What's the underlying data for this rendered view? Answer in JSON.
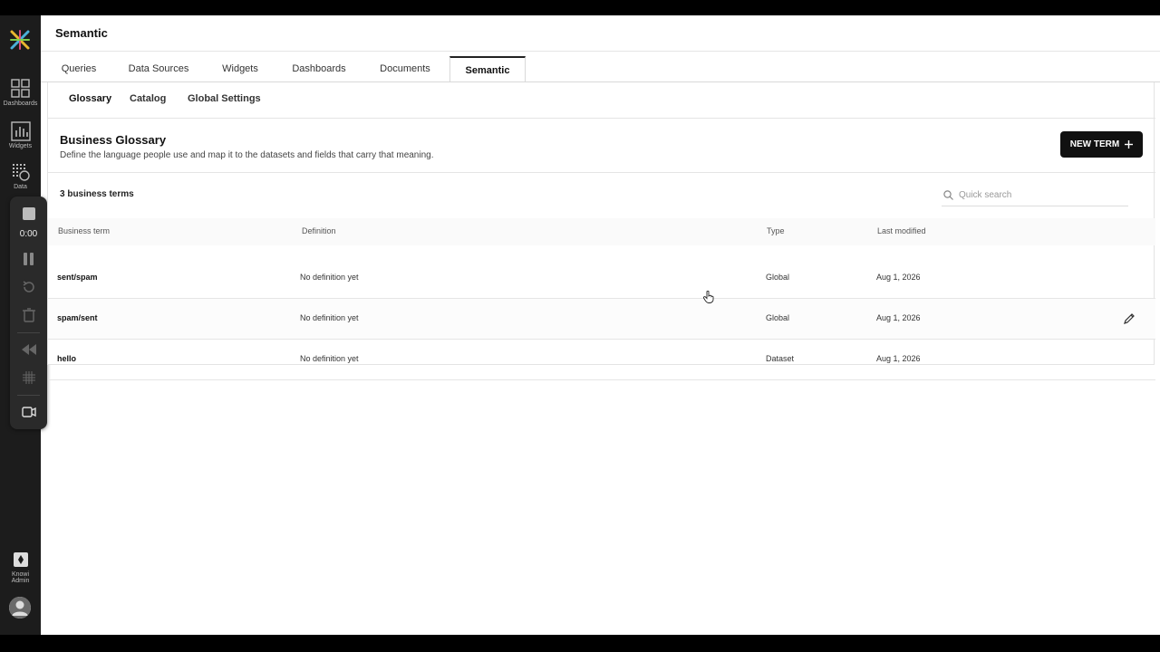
{
  "app": {
    "page_title": "Semantic",
    "colors": {
      "accent": "#111111",
      "sidebar": "#1c1c1c"
    }
  },
  "sidebar": {
    "items": [
      {
        "label": "Dashboards",
        "icon": "dashboards-grid-icon"
      },
      {
        "label": "Widgets",
        "icon": "bar-chart-icon"
      },
      {
        "label": "Data",
        "icon": "data-icon"
      }
    ],
    "admin": {
      "line1": "Knowi",
      "line2": "Admin",
      "icon": "admin-icon"
    }
  },
  "recorder": {
    "time": "0:00"
  },
  "tabs": [
    {
      "label": "Queries"
    },
    {
      "label": "Data Sources"
    },
    {
      "label": "Widgets"
    },
    {
      "label": "Dashboards"
    },
    {
      "label": "Documents"
    },
    {
      "label": "Semantic",
      "active": true
    }
  ],
  "subtabs": [
    {
      "label": "Glossary",
      "active": true
    },
    {
      "label": "Catalog"
    },
    {
      "label": "Global Settings"
    }
  ],
  "glossary": {
    "title": "Business Glossary",
    "description": "Define the language people use and map it to the datasets and fields that carry that meaning.",
    "new_button": "NEW TERM",
    "count_label": "3 business terms",
    "search_placeholder": "Quick search"
  },
  "table": {
    "columns": [
      "Business term",
      "Definition",
      "Type",
      "Last modified"
    ],
    "rows": [
      {
        "term": "sent/spam",
        "definition": "No definition yet",
        "type": "Global",
        "modified": "Aug 1, 2026"
      },
      {
        "term": "spam/sent",
        "definition": "No definition yet",
        "type": "Global",
        "modified": "Aug 1, 2026"
      },
      {
        "term": "hello",
        "definition": "No definition yet",
        "type": "Dataset",
        "modified": "Aug 1, 2026"
      }
    ]
  }
}
